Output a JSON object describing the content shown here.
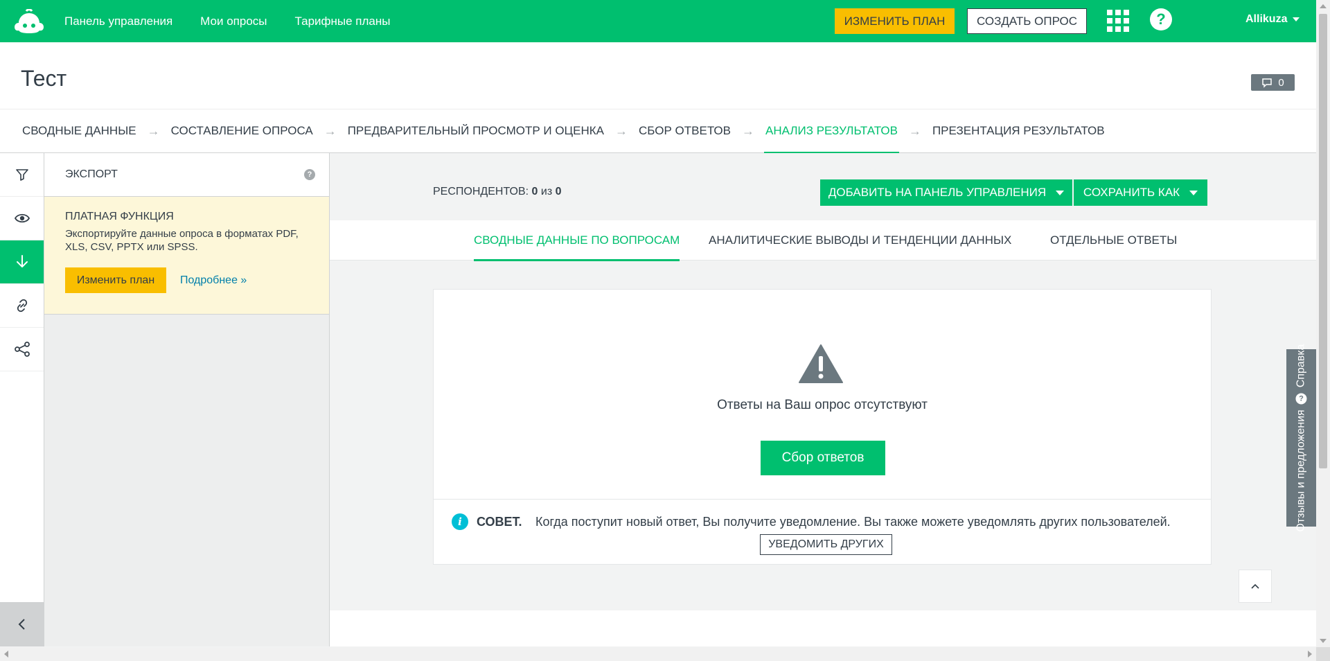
{
  "topbar": {
    "nav": [
      "Панель управления",
      "Мои опросы",
      "Тарифные планы"
    ],
    "upgrade_label": "ИЗМЕНИТЬ ПЛАН",
    "create_label": "СОЗДАТЬ ОПРОС",
    "help_glyph": "?",
    "username": "Allikuza",
    "brand_color": "#00bf6f",
    "accent_color": "#f9be00"
  },
  "title": {
    "text": "Тест",
    "comment_count": "0"
  },
  "steps": [
    {
      "label": "СВОДНЫЕ ДАННЫЕ",
      "active": false
    },
    {
      "label": "СОСТАВЛЕНИЕ ОПРОСА",
      "active": false
    },
    {
      "label": "ПРЕДВАРИТЕЛЬНЫЙ ПРОСМОТР И ОЦЕНКА",
      "active": false
    },
    {
      "label": "СБОР ОТВЕТОВ",
      "active": false
    },
    {
      "label": "АНАЛИЗ РЕЗУЛЬТАТОВ",
      "active": true
    },
    {
      "label": "ПРЕЗЕНТАЦИЯ РЕЗУЛЬТАТОВ",
      "active": false
    }
  ],
  "step_arrow": "→",
  "rail": {
    "items": [
      "filter-icon",
      "eye-icon",
      "download-icon",
      "link-icon",
      "share-icon"
    ],
    "active_index": 2
  },
  "export_panel": {
    "title": "ЭКСПОРТ",
    "help_glyph": "?",
    "paid_title": "ПЛАТНАЯ ФУНКЦИЯ",
    "paid_text": "Экспортируйте данные опроса в форматах PDF, XLS, CSV, PPTX или SPSS.",
    "plan_button": "Изменить план",
    "more_link": "Подробнее »"
  },
  "main": {
    "respondents_label": "РЕСПОНДЕНТОВ:",
    "respondents_count": "0",
    "respondents_of": "из",
    "respondents_total": "0",
    "add_to_dashboard": "ДОБАВИТЬ НА ПАНЕЛЬ УПРАВЛЕНИЯ",
    "save_as": "СОХРАНИТЬ КАК",
    "subtabs": [
      {
        "label": "СВОДНЫЕ ДАННЫЕ ПО ВОПРОСАМ",
        "active": true
      },
      {
        "label": "АНАЛИТИЧЕСКИЕ ВЫВОДЫ И ТЕНДЕНЦИИ ДАННЫХ",
        "active": false
      },
      {
        "label": "ОТДЕЛЬНЫЕ ОТВЕТЫ",
        "active": false
      }
    ],
    "empty_text": "Ответы на Ваш опрос отсутствуют",
    "collect_button": "Сбор ответов",
    "tip_label": "СОВЕТ.",
    "tip_text": "Когда поступит новый ответ, Вы получите уведомление. Вы также можете уведомлять других пользователей.",
    "notify_button": "УВЕДОМИТЬ ДРУГИХ"
  },
  "feedback": {
    "label": "Отзывы и предложения",
    "help_label": "Справка"
  }
}
